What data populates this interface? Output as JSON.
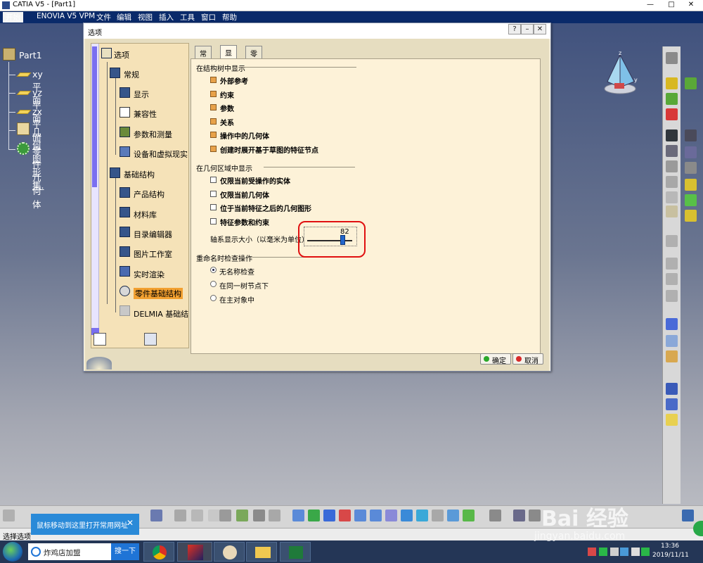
{
  "window": {
    "title": "CATIA V5 - [Part1]",
    "min": "—",
    "max": "□",
    "close": "✕"
  },
  "menu": {
    "items": [
      "开始",
      "ENOVIA V5 VPM",
      "文件",
      "编辑",
      "视图",
      "插入",
      "工具",
      "窗口",
      "帮助"
    ]
  },
  "tree": {
    "root": "Part1",
    "items": [
      "xy 平面",
      "yz 平面",
      "zx 平面",
      "几何图形集.",
      "零件几何体"
    ]
  },
  "dialog": {
    "title": "选项",
    "categories": {
      "root": "选项",
      "general": "常规",
      "display": "显示",
      "compat": "兼容性",
      "param": "参数和测量",
      "devices": "设备和虚拟现实",
      "infra": "基础结构",
      "product": "产品结构",
      "material": "材料库",
      "catalog": "目录编辑器",
      "photo": "图片工作室",
      "render": "实时渲染",
      "partinfra": "零件基础结构",
      "delmia": "DELMIA 基础结"
    },
    "tabs": [
      "常规",
      "显示",
      "零件文档"
    ],
    "active_tab": "显示",
    "section_tree": "在结构树中显示",
    "tree_options": [
      "外部参考",
      "约束",
      "参数",
      "关系",
      "操作中的几何体",
      "创建时展开基于草图的特征节点"
    ],
    "section_geom": "在几何区域中显示",
    "geom_options": [
      "仅限当前受操作的实体",
      "仅限当前几何体",
      "位于当前特征之后的几何图形",
      "特征参数和约束"
    ],
    "axis_label": "轴系显示大小（以毫米为单位）",
    "axis_value": "82",
    "axis_fraction": 0.82,
    "section_rename": "重命名时检查操作",
    "rename_options": [
      "无名称检查",
      "在同一树节点下",
      "在主对象中"
    ],
    "rename_selected": 0,
    "ok": "确定",
    "cancel": "取消"
  },
  "status": {
    "text": "选择选项",
    "tooltip": "鼠标移动到这里打开常用网址"
  },
  "taskbar": {
    "search_text": "炸鸡店加盟",
    "search_button": "搜一下",
    "time": "13:36",
    "date": "2019/11/11"
  },
  "colors": {
    "accent": "#0a2a6a",
    "checkbox_on": "#e8a24a",
    "highlight": "#e01010",
    "slider": "#2266cc"
  }
}
